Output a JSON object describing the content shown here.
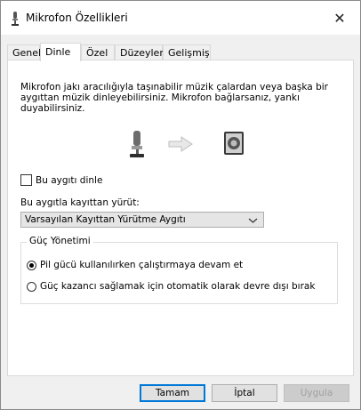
{
  "window": {
    "title": "Mikrofon Özellikleri",
    "title_icon": "microphone-icon",
    "close_glyph": "✕"
  },
  "tabs": [
    {
      "label": "Genel"
    },
    {
      "label": "Dinle"
    },
    {
      "label": "Özel"
    },
    {
      "label": "Düzeyler"
    },
    {
      "label": "Gelişmiş"
    }
  ],
  "active_tab": "Dinle",
  "listen": {
    "description": "Mikrofon jakı aracılığıyla taşınabilir müzik çalardan veya başka bir aygıttan müzik dinleyebilirsiniz. Mikrofon bağlarsanız, yankı duyabilirsiniz.",
    "illustration_icons": [
      "microphone-icon",
      "right-arrow-icon",
      "speaker-icon"
    ],
    "listen_checkbox_label": "Bu aygıtı dinle",
    "listen_checked": false,
    "playback_label": "Bu aygıtla kayıttan yürüt:",
    "playback_selected": "Varsayılan Kayıttan Yürütme Aygıtı",
    "power_group_title": "Güç Yönetimi",
    "power_options": [
      {
        "label": "Pil gücü kullanılırken çalıştırmaya devam et",
        "checked": true
      },
      {
        "label": "Güç kazancı sağlamak için otomatik olarak devre dışı bırak",
        "checked": false
      }
    ]
  },
  "buttons": {
    "ok": "Tamam",
    "cancel": "İptal",
    "apply": "Uygula"
  },
  "colors": {
    "accent": "#0078d7",
    "window_bg": "#f0f0f0",
    "panel_bg": "#ffffff"
  }
}
